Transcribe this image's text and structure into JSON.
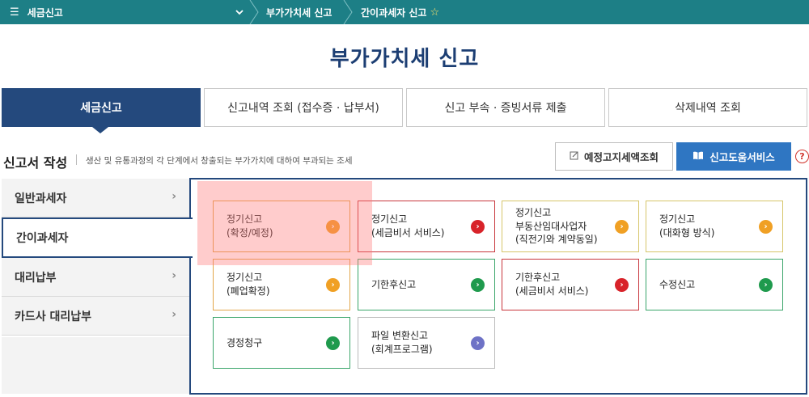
{
  "topbar": {
    "menu_icon": "hamburger-icon",
    "menu_label": "세금신고",
    "crumb1": "부가가치세 신고",
    "crumb2": "간이과세자 신고",
    "star_icon": "star-outline-icon"
  },
  "page_title": "부가가치세 신고",
  "tabs": [
    {
      "label": "세금신고",
      "active": true
    },
    {
      "label": "신고내역 조회 (접수증 · 납부서)",
      "active": false
    },
    {
      "label": "신고 부속 · 증빙서류 제출",
      "active": false
    },
    {
      "label": "삭제내역 조회",
      "active": false
    }
  ],
  "section": {
    "title": "신고서 작성",
    "description": "생산 및 유통과정의 각 단계에서 창출되는 부가가치에 대하여 부과되는 조세",
    "btn_notice": "예정고지세액조회",
    "btn_help": "신고도움서비스",
    "help_mark": "?"
  },
  "sidebar": {
    "items": [
      {
        "label": "일반과세자",
        "selected": false
      },
      {
        "label": "간이과세자",
        "selected": true
      },
      {
        "label": "대리납부",
        "selected": false
      },
      {
        "label": "카드사 대리납부",
        "selected": false
      }
    ]
  },
  "cards": [
    {
      "line1": "정기신고",
      "line2": "(확정/예정)",
      "line3": "",
      "color": "orange"
    },
    {
      "line1": "정기신고",
      "line2": "(세금비서 서비스)",
      "line3": "",
      "color": "red"
    },
    {
      "line1": "정기신고",
      "line2": "부동산임대사업자",
      "line3": "(직전기와 계약동일)",
      "color": "yellow"
    },
    {
      "line1": "정기신고",
      "line2": "(대화형 방식)",
      "line3": "",
      "color": "yellow"
    },
    {
      "line1": "정기신고",
      "line2": "(폐업확정)",
      "line3": "",
      "color": "orange"
    },
    {
      "line1": "기한후신고",
      "line2": "",
      "line3": "",
      "color": "green"
    },
    {
      "line1": "기한후신고",
      "line2": "(세금비서 서비스)",
      "line3": "",
      "color": "red"
    },
    {
      "line1": "수정신고",
      "line2": "",
      "line3": "",
      "color": "green"
    },
    {
      "line1": "경정청구",
      "line2": "",
      "line3": "",
      "color": "green"
    },
    {
      "line1": "파일 변환신고",
      "line2": "(회계프로그램)",
      "line3": "",
      "color": "purple"
    }
  ],
  "colors": {
    "topbar": "#1d7f86",
    "navy": "#24497d",
    "help_button": "#2f76c2",
    "orange": "#f0a024",
    "red": "#d8232a",
    "green": "#1f9a4d",
    "purple": "#6e72c6"
  }
}
